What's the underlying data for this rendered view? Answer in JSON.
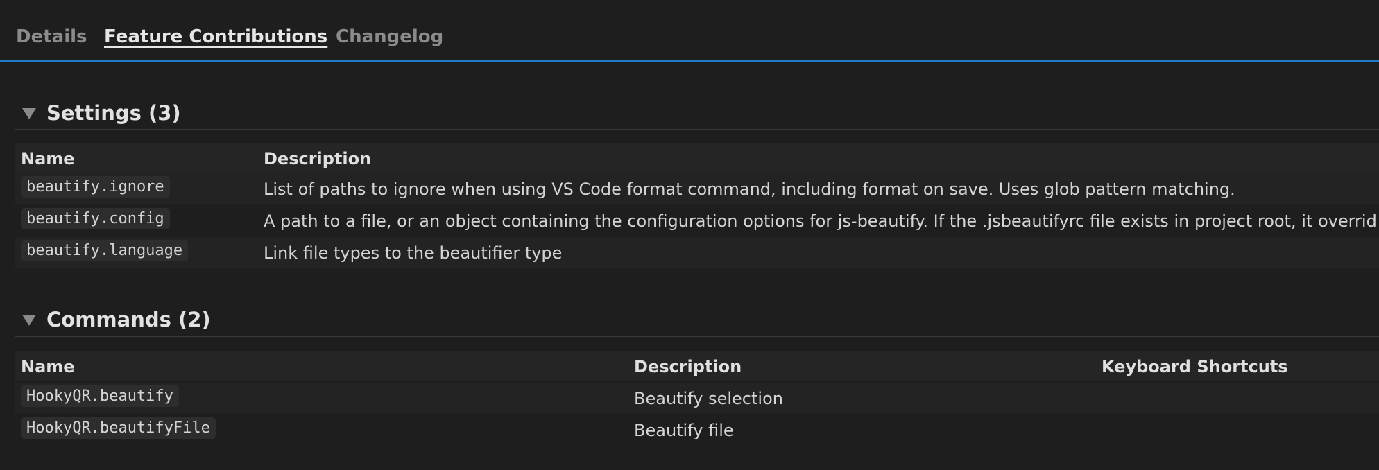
{
  "tabs": [
    {
      "label": "Details"
    },
    {
      "label": "Feature Contributions"
    },
    {
      "label": "Changelog"
    }
  ],
  "settings": {
    "title": "Settings (3)",
    "columns": [
      "Name",
      "Description"
    ],
    "rows": [
      {
        "name": "beautify.ignore",
        "description": "List of paths to ignore when using VS Code format command, including format on save. Uses glob pattern matching."
      },
      {
        "name": "beautify.config",
        "description": "A path to a file, or an object containing the configuration options for js-beautify. If the .jsbeautifyrc file exists in project root, it overrid"
      },
      {
        "name": "beautify.language",
        "description": "Link file types to the beautifier type"
      }
    ]
  },
  "commands": {
    "title": "Commands (2)",
    "columns": [
      "Name",
      "Description",
      "Keyboard Shortcuts"
    ],
    "rows": [
      {
        "name": "HookyQR.beautify",
        "description": "Beautify selection",
        "shortcut": ""
      },
      {
        "name": "HookyQR.beautifyFile",
        "description": "Beautify file",
        "shortcut": ""
      }
    ]
  },
  "colors": {
    "background": "#1e1e1e",
    "accent": "#1f79c7"
  }
}
